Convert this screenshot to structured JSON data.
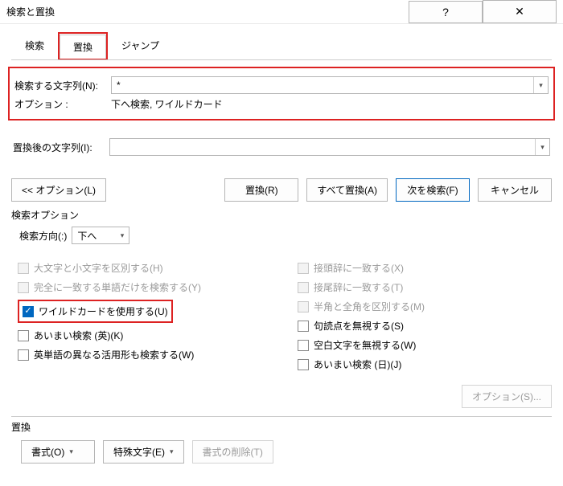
{
  "titlebar": {
    "title": "検索と置換",
    "help": "?",
    "close": "✕"
  },
  "tabs": {
    "find": "検索",
    "replace": "置換",
    "goto": "ジャンプ"
  },
  "find": {
    "label": "検索する文字列(N):",
    "value": "*",
    "options_label": "オプション :",
    "options_value": "下へ検索, ワイルドカード"
  },
  "replace": {
    "label": "置換後の文字列(I):",
    "value": ""
  },
  "buttons": {
    "less": "<< オプション(L)",
    "replace": "置換(R)",
    "replace_all": "すべて置換(A)",
    "find_next": "次を検索(F)",
    "cancel": "キャンセル"
  },
  "search_options": {
    "title": "検索オプション",
    "direction_label": "検索方向(:)",
    "direction_value": "下へ",
    "left": {
      "match_case": "大文字と小文字を区別する(H)",
      "whole_word": "完全に一致する単語だけを検索する(Y)",
      "wildcards": "ワイルドカードを使用する(U)",
      "sounds_like_en": "あいまい検索 (英)(K)",
      "word_forms": "英単語の異なる活用形も検索する(W)"
    },
    "right": {
      "prefix": "接頭辞に一致する(X)",
      "suffix": "接尾辞に一致する(T)",
      "width": "半角と全角を区別する(M)",
      "punct": "句読点を無視する(S)",
      "whitespace": "空白文字を無視する(W)",
      "sounds_like_jp": "あいまい検索 (日)(J)",
      "options_s": "オプション(S)..."
    }
  },
  "bottom": {
    "title": "置換",
    "format": "書式(O)",
    "special": "特殊文字(E)",
    "no_format": "書式の削除(T)"
  }
}
